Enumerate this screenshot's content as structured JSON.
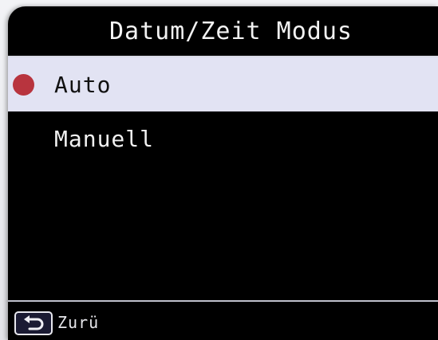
{
  "header": {
    "title": "Datum/Zeit Modus"
  },
  "options": [
    {
      "label": "Auto",
      "selected": true
    },
    {
      "label": "Manuell",
      "selected": false
    }
  ],
  "footer": {
    "back_label": "Zurü",
    "back_icon": "return-arrow-icon"
  },
  "colors": {
    "screen_background": "#000000",
    "selected_row": "#e2e3f3",
    "selected_dot": "#b8343e",
    "text": "#f1f1f1"
  }
}
